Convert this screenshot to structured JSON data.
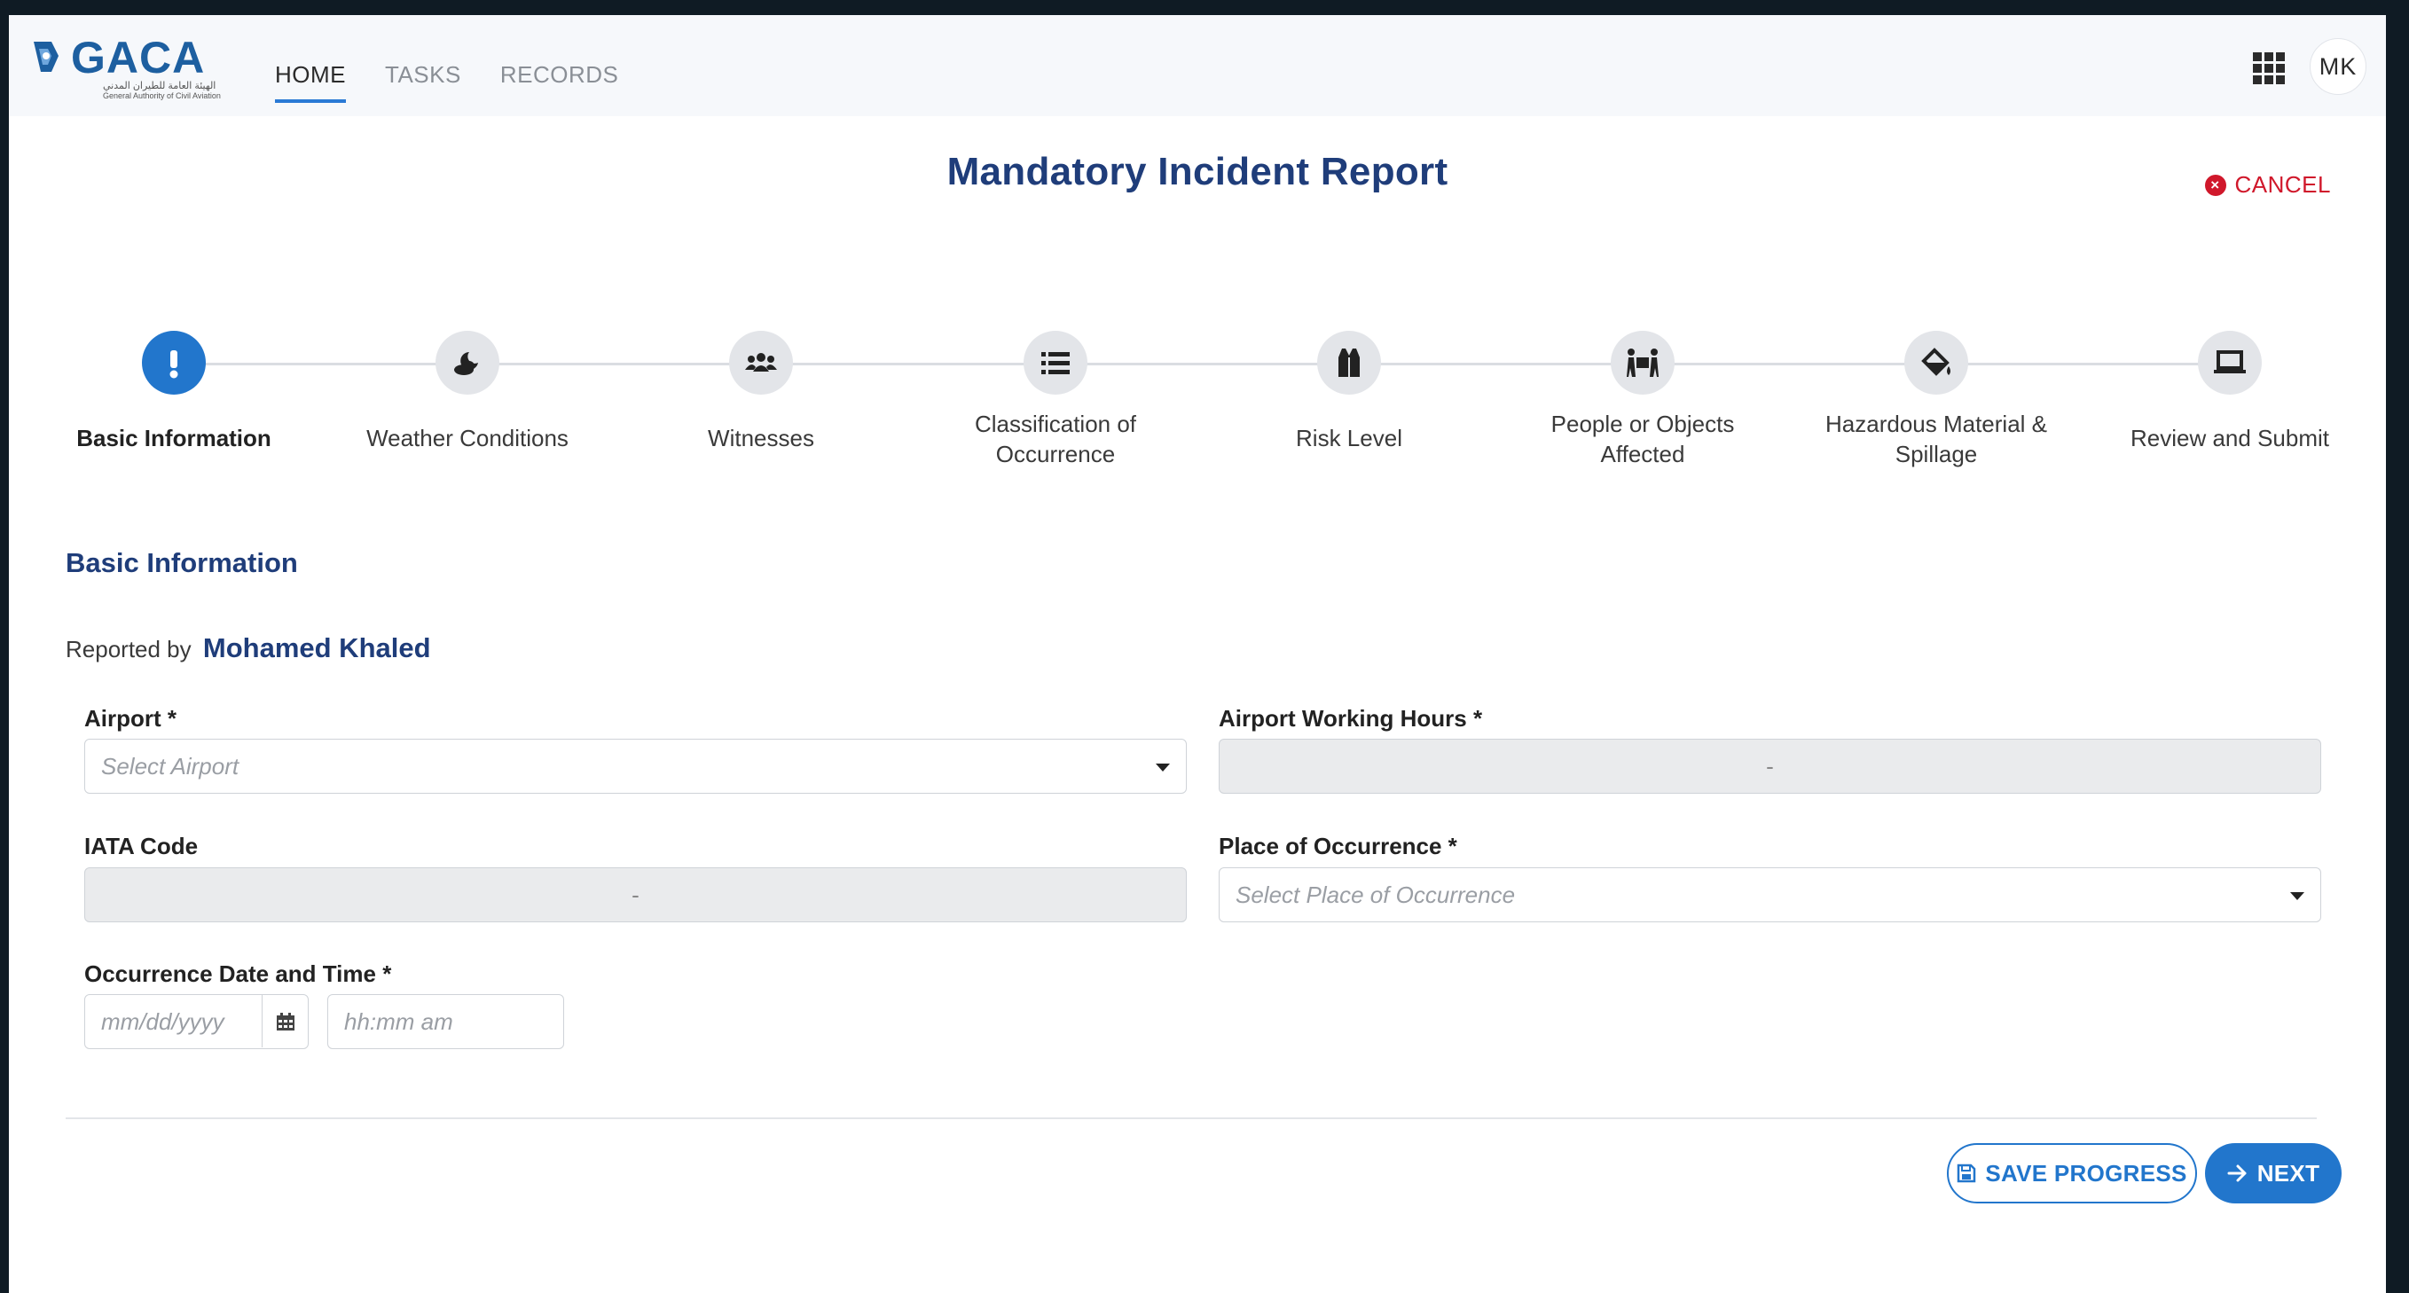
{
  "header": {
    "logo": {
      "wordmark": "GACA",
      "arabic": "الهيئة العامة للطيران المدني",
      "english": "General Authority of Civil Aviation"
    },
    "nav": [
      {
        "label": "HOME",
        "active": true
      },
      {
        "label": "TASKS",
        "active": false
      },
      {
        "label": "RECORDS",
        "active": false
      }
    ],
    "apps_icon": "grid-icon",
    "user_initials": "MK"
  },
  "page": {
    "title": "Mandatory Incident Report",
    "cancel_label": "CANCEL"
  },
  "stepper": {
    "active_color": "#2276cc",
    "steps": [
      {
        "label": "Basic Information",
        "icon": "exclamation-icon",
        "active": true
      },
      {
        "label": "Weather Conditions",
        "icon": "weather-icon",
        "active": false
      },
      {
        "label": "Witnesses",
        "icon": "users-icon",
        "active": false
      },
      {
        "label": "Classification of Occurrence",
        "icon": "list-icon",
        "active": false
      },
      {
        "label": "Risk Level",
        "icon": "vest-icon",
        "active": false
      },
      {
        "label": "People or Objects Affected",
        "icon": "people-carry-icon",
        "active": false
      },
      {
        "label": "Hazardous Material & Spillage",
        "icon": "fill-drip-icon",
        "active": false
      },
      {
        "label": "Review and Submit",
        "icon": "laptop-icon",
        "active": false
      }
    ]
  },
  "form": {
    "section_title": "Basic Information",
    "reported_by_label": "Reported by",
    "reported_by_name": "Mohamed Khaled",
    "airport": {
      "label": "Airport *",
      "placeholder": "Select Airport"
    },
    "working_hours": {
      "label": "Airport Working Hours *",
      "value": "-"
    },
    "iata": {
      "label": "IATA Code",
      "value": "-"
    },
    "place": {
      "label": "Place of Occurrence *",
      "placeholder": "Select Place of Occurrence"
    },
    "datetime": {
      "label": "Occurrence Date and Time *",
      "date_placeholder": "mm/dd/yyyy",
      "time_placeholder": "hh:mm am"
    }
  },
  "actions": {
    "save_label": "SAVE PROGRESS",
    "next_label": "NEXT"
  }
}
